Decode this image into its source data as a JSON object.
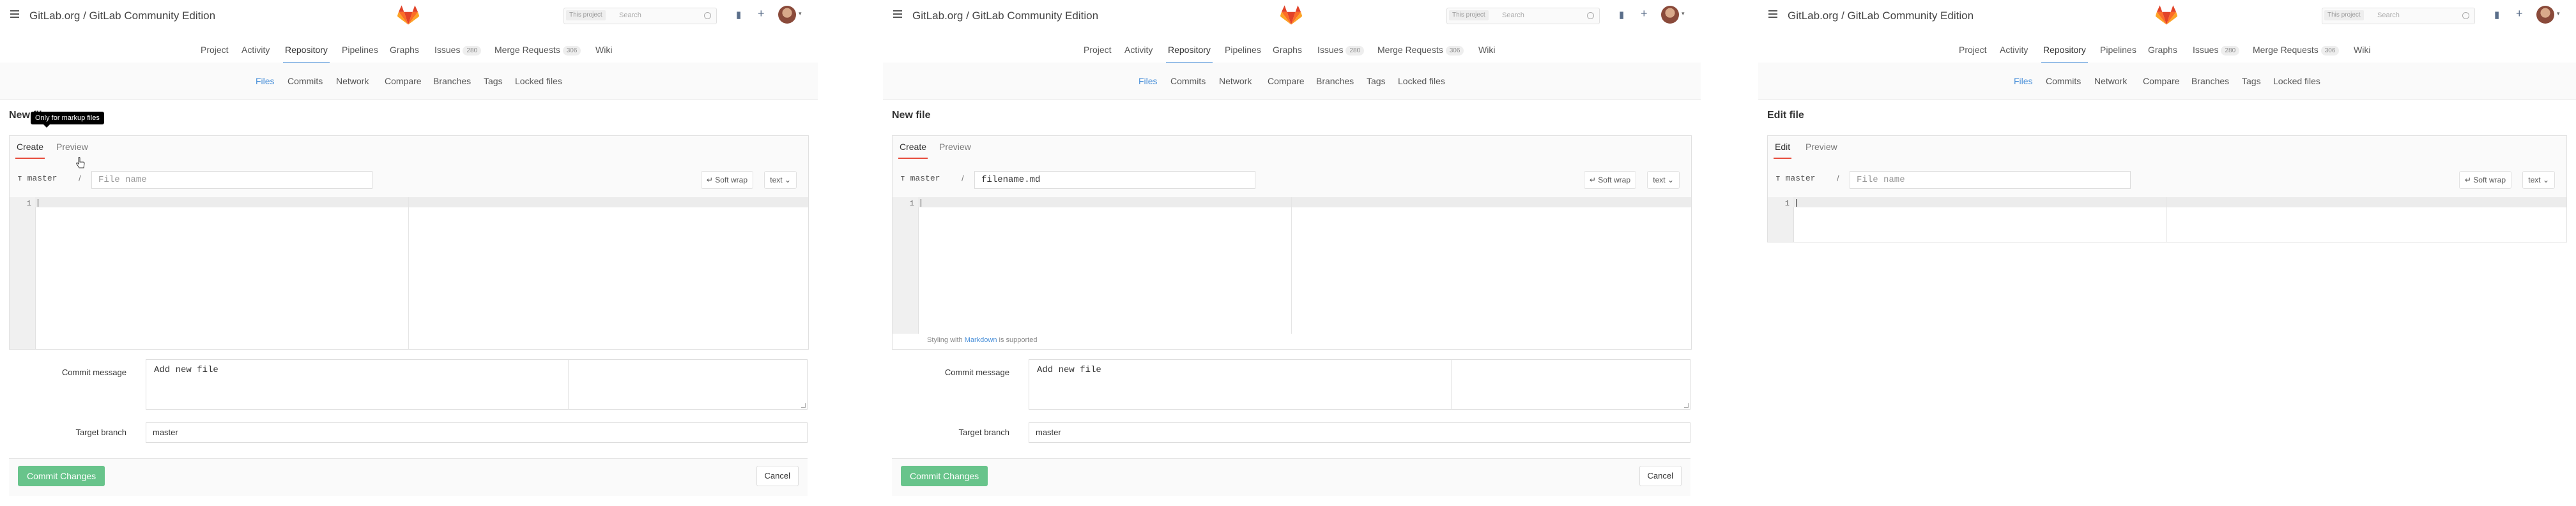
{
  "header": {
    "title": "GitLab.org / GitLab Community Edition",
    "search_scope": "This project",
    "search_placeholder": "Search",
    "accent_color": "#4a90d9",
    "logo_color": "#e24329"
  },
  "nav": {
    "tabs": [
      {
        "label": "Project"
      },
      {
        "label": "Activity"
      },
      {
        "label": "Repository"
      },
      {
        "label": "Pipelines"
      },
      {
        "label": "Graphs"
      },
      {
        "label": "Issues",
        "badge": "280"
      },
      {
        "label": "Merge Requests",
        "badge": "306"
      },
      {
        "label": "Wiki"
      }
    ],
    "subtabs": [
      {
        "label": "Files"
      },
      {
        "label": "Commits"
      },
      {
        "label": "Network"
      },
      {
        "label": "Compare"
      },
      {
        "label": "Branches"
      },
      {
        "label": "Tags"
      },
      {
        "label": "Locked files"
      }
    ]
  },
  "panels": [
    {
      "heading": "New file",
      "tooltip": "Only for markup files",
      "tabs": [
        "Create",
        "Preview"
      ],
      "branch": "master",
      "slash": "/",
      "filename": "",
      "filename_placeholder": "File name",
      "soft_wrap": "Soft wrap",
      "lang": "text",
      "line": "1"
    },
    {
      "heading": "New file",
      "tabs": [
        "Create",
        "Preview"
      ],
      "branch": "master",
      "slash": "/",
      "filename": "filename.md",
      "soft_wrap": "Soft wrap",
      "lang": "text",
      "line": "1",
      "md_prefix": "Styling with",
      "md_link": "Markdown",
      "md_suffix": "is supported"
    },
    {
      "heading": "Edit file",
      "tabs": [
        "Edit",
        "Preview"
      ],
      "branch": "master",
      "slash": "/",
      "filename": "",
      "filename_placeholder": "File name",
      "soft_wrap": "Soft wrap",
      "lang": "text",
      "line": "1"
    }
  ],
  "form": {
    "commit_label": "Commit message",
    "commit_value": "Add new file",
    "branch_label": "Target branch",
    "branch_value": "master",
    "submit": "Commit Changes",
    "cancel": "Cancel",
    "submit_color": "#68c48b"
  }
}
